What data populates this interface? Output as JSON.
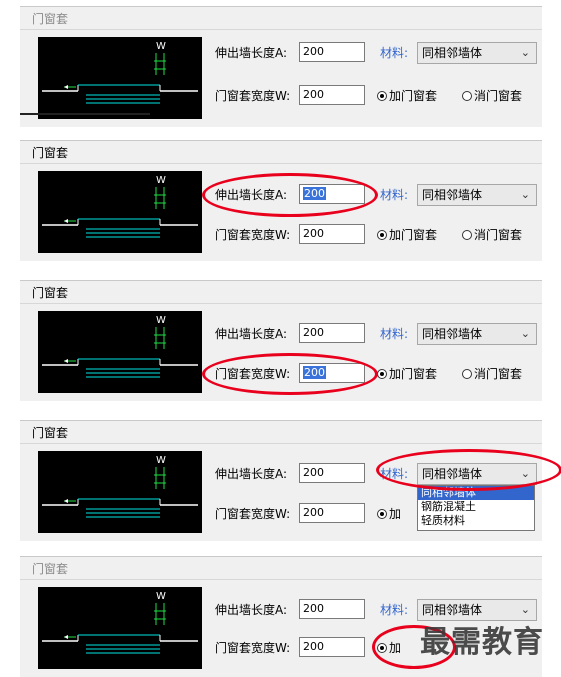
{
  "dialog": {
    "title": "门窗套",
    "length_label": "伸出墙长度A:",
    "width_label": "门窗套宽度W:",
    "length_value": "200",
    "width_value": "200",
    "material_label": "材料:",
    "material_value": "同相邻墙体",
    "add_label": "加门窗套",
    "remove_label": "消门窗套",
    "preview_w_label": "W"
  },
  "material_options": [
    "同相邻墙体",
    "钢筋混凝土",
    "轻质材料"
  ],
  "watermark": "最需教育",
  "colors": {
    "highlight_ring": "#e8001c",
    "material_label": "#3366cc",
    "selection": "#3a73d9",
    "preview_bg": "#000000",
    "preview_cyan": "#00e5e5",
    "preview_green": "#22dd44"
  }
}
